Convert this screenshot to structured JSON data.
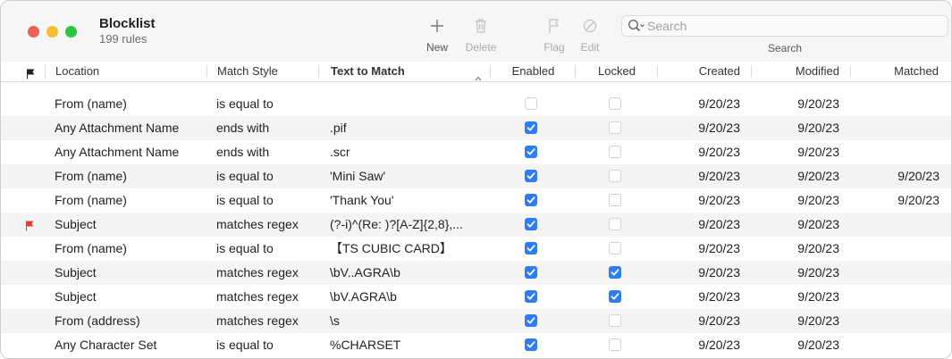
{
  "window": {
    "title": "Blocklist",
    "subtitle": "199 rules"
  },
  "toolbar": {
    "new_label": "New",
    "delete_label": "Delete",
    "flag_label": "Flag",
    "edit_label": "Edit",
    "search_placeholder": "Search",
    "search_label": "Search"
  },
  "columns": {
    "location": "Location",
    "match_style": "Match Style",
    "text_to_match": "Text to Match",
    "enabled": "Enabled",
    "locked": "Locked",
    "created": "Created",
    "modified": "Modified",
    "matched": "Matched"
  },
  "rows": [
    {
      "flag": false,
      "location": "From (name)",
      "match_style": "is equal to",
      "text": "",
      "enabled": false,
      "locked": false,
      "created": "9/20/23",
      "modified": "9/20/23",
      "matched": ""
    },
    {
      "flag": false,
      "location": "Any Attachment Name",
      "match_style": "ends with",
      "text": ".pif",
      "enabled": true,
      "locked": false,
      "created": "9/20/23",
      "modified": "9/20/23",
      "matched": ""
    },
    {
      "flag": false,
      "location": "Any Attachment Name",
      "match_style": "ends with",
      "text": ".scr",
      "enabled": true,
      "locked": false,
      "created": "9/20/23",
      "modified": "9/20/23",
      "matched": ""
    },
    {
      "flag": false,
      "location": "From (name)",
      "match_style": "is equal to",
      "text": "'Mini Saw'",
      "enabled": true,
      "locked": false,
      "created": "9/20/23",
      "modified": "9/20/23",
      "matched": "9/20/23"
    },
    {
      "flag": false,
      "location": "From (name)",
      "match_style": "is equal to",
      "text": "'Thank You'",
      "enabled": true,
      "locked": false,
      "created": "9/20/23",
      "modified": "9/20/23",
      "matched": "9/20/23"
    },
    {
      "flag": true,
      "location": "Subject",
      "match_style": "matches regex",
      "text": "(?-i)^(Re: )?[A-Z]{2,8},...",
      "enabled": true,
      "locked": false,
      "created": "9/20/23",
      "modified": "9/20/23",
      "matched": ""
    },
    {
      "flag": false,
      "location": "From (name)",
      "match_style": "is equal to",
      "text": "【TS CUBIC CARD】",
      "enabled": true,
      "locked": false,
      "created": "9/20/23",
      "modified": "9/20/23",
      "matched": ""
    },
    {
      "flag": false,
      "location": "Subject",
      "match_style": "matches regex",
      "text": "\\bV..AGRA\\b",
      "enabled": true,
      "locked": true,
      "created": "9/20/23",
      "modified": "9/20/23",
      "matched": ""
    },
    {
      "flag": false,
      "location": "Subject",
      "match_style": "matches regex",
      "text": "\\bV.AGRA\\b",
      "enabled": true,
      "locked": true,
      "created": "9/20/23",
      "modified": "9/20/23",
      "matched": ""
    },
    {
      "flag": false,
      "location": "From (address)",
      "match_style": "matches regex",
      "text": "\\s",
      "enabled": true,
      "locked": false,
      "created": "9/20/23",
      "modified": "9/20/23",
      "matched": ""
    },
    {
      "flag": false,
      "location": "Any Character Set",
      "match_style": "is equal to",
      "text": "%CHARSET",
      "enabled": true,
      "locked": false,
      "created": "9/20/23",
      "modified": "9/20/23",
      "matched": ""
    }
  ],
  "colors": {
    "close": "#ee5f58",
    "minimize": "#f6be30",
    "zoom": "#29c840",
    "checkbox_on": "#2e7cf6",
    "flag": "#ee3b2f",
    "row_alt": "#f4f4f4"
  },
  "icons": {
    "new": "plus-icon",
    "delete": "trash-icon",
    "flag": "flag-icon",
    "edit": "prohibited-icon",
    "search": "magnifier-icon",
    "header_flag": "flag-icon",
    "sort": "chevron-up-icon"
  }
}
